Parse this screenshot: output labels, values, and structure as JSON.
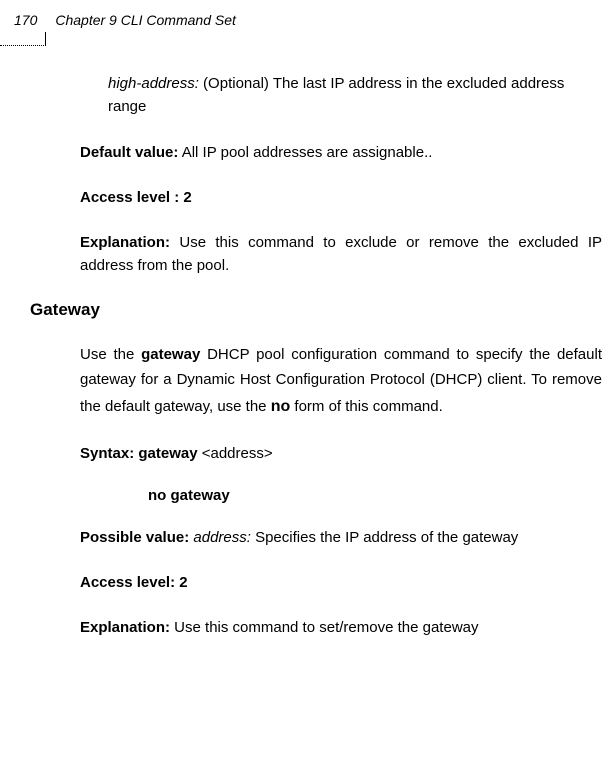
{
  "header": {
    "pageNumber": "170",
    "chapterTitle": "Chapter 9 CLI Command Set"
  },
  "content": {
    "highAddress": {
      "label": "high-address:",
      "text": " (Optional) The last IP address in the excluded address range"
    },
    "defaultValue": {
      "label": "Default value:",
      "text": " All IP pool addresses are assignable.."
    },
    "accessLevel1": {
      "label": "Access level : 2"
    },
    "explanation1": {
      "label": "Explanation:",
      "text": " Use this command to exclude or remove the excluded IP address from the pool."
    },
    "sectionHeading": "Gateway",
    "gatewayIntro": {
      "text1": "Use the ",
      "bold1": "gateway",
      "text2": " DHCP pool configuration command to specify the default gateway for a Dynamic Host Configuration Protocol (DHCP) client. To remove the default gateway, use the ",
      "bold2": "no",
      "text3": " form of this command."
    },
    "syntax": {
      "label": "Syntax:  gateway",
      "param": " <address>"
    },
    "noGateway": "no gateway",
    "possibleValue": {
      "label": "Possible value:",
      "italic": " address:",
      "text": " Specifies the IP address of the gateway"
    },
    "accessLevel2": {
      "label": "Access level: 2"
    },
    "explanation2": {
      "label": "Explanation:",
      "text": " Use this command to set/remove the gateway"
    }
  }
}
